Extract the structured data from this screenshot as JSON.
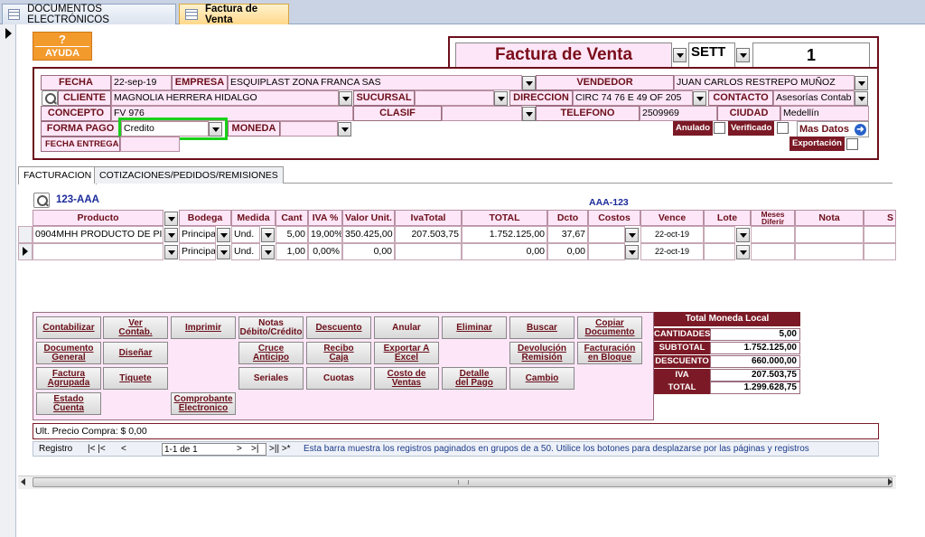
{
  "tabs": [
    {
      "label": "DOCUMENTOS ELECTRÓNICOS"
    },
    {
      "label": "Factura de Venta"
    }
  ],
  "help": {
    "icon": "?",
    "label": "AYUDA"
  },
  "header": {
    "title": "Factura de Venta",
    "serie": "SETT",
    "number": "1"
  },
  "form": {
    "fecha_label": "FECHA",
    "fecha": "22-sep-19",
    "empresa_label": "EMPRESA",
    "empresa": "ESQUIPLAST ZONA FRANCA SAS",
    "vendedor_label": "VENDEDOR",
    "vendedor": "JUAN CARLOS RESTREPO MUÑOZ",
    "cliente_label": "CLIENTE",
    "cliente": "MAGNOLIA HERRERA HIDALGO",
    "sucursal_label": "SUCURSAL",
    "sucursal": "",
    "direccion_label": "DIRECCION",
    "direccion": "CIRC 74 76 E 49 OF 205",
    "contacto_label": "CONTACTO",
    "contacto": "Asesorías Contab",
    "concepto_label": "CONCEPTO",
    "concepto": "FV 976",
    "clasif_label": "CLASIF",
    "clasif": "",
    "telefono_label": "TELEFONO",
    "telefono": "2509969",
    "ciudad_label": "CIUDAD",
    "ciudad": "Medellín",
    "forma_pago_label": "FORMA PAGO",
    "forma_pago": "Credito",
    "moneda_label": "MONEDA",
    "moneda": "",
    "fecha_entrega_label": "FECHA ENTREGA",
    "anulado_label": "Anulado",
    "verificado_label": "Verificado",
    "mas_datos_label": "Mas Datos",
    "exportacion_label": "Exportación"
  },
  "subtabs": [
    {
      "label": "FACTURACION"
    },
    {
      "label": "COTIZACIONES/PEDIDOS/REMISIONES"
    }
  ],
  "grid": {
    "code_left": "123-AAA",
    "code_right": "AAA-123",
    "headers": [
      "Producto",
      "Bodega",
      "Medida",
      "Cant",
      "IVA %",
      "Valor Unit.",
      "IvaTotal",
      "TOTAL",
      "Dcto",
      "Costos",
      "Vence",
      "Lote",
      "Meses Diferir",
      "Nota",
      "S"
    ],
    "rows": [
      {
        "producto": "0904MHH PRODUCTO DE PI",
        "bodega": "Principal",
        "medida": "Und.",
        "cant": "5,00",
        "iva": "19,00%",
        "valor": "350.425,00",
        "ivatotal": "207.503,75",
        "total": "1.752.125,00",
        "dcto": "37,67",
        "costos": "",
        "vence": "22-oct-19",
        "lote": "",
        "meses": "",
        "nota": ""
      },
      {
        "producto": "",
        "bodega": "Principal",
        "medida": "Und.",
        "cant": "1,00",
        "iva": "0,00%",
        "valor": "0,00",
        "ivatotal": "",
        "total": "0,00",
        "dcto": "0,00",
        "costos": "",
        "vence": "22-oct-19",
        "lote": "",
        "meses": "",
        "nota": ""
      }
    ]
  },
  "buttons": {
    "contabilizar": "Contabilizar",
    "ver_contab": "Ver\nContab.",
    "imprimir": "Imprimir",
    "notas": "Notas\nDébito/Crédito",
    "descuento": "Descuento",
    "anular": "Anular",
    "eliminar": "Eliminar",
    "buscar": "Buscar",
    "copiar": "Copiar\nDocumento",
    "doc_general": "Documento\nGeneral",
    "disenar": "Diseñar",
    "cruce": "Cruce\nAnticipo",
    "recibo": "Recibo\nCaja",
    "exportar": "Exportar A\nExcel",
    "devolucion": "Devolución\nRemisión",
    "fact_bloque": "Facturación\nen Bloque",
    "fact_agrupada": "Factura\nAgrupada",
    "tiquete": "Tiquete",
    "seriales": "Seriales",
    "cuotas": "Cuotas",
    "costo_ventas": "Costo de\nVentas",
    "detalle_pago": "Detalle\ndel Pago",
    "cambio": "Cambio",
    "estado_cuenta": "Estado\nCuenta",
    "comprobante": "Comprobante\nElectronico"
  },
  "totals": {
    "title": "Total Moneda Local",
    "rows": [
      {
        "label": "CANTIDADES",
        "value": "5,00"
      },
      {
        "label": "SUBTOTAL",
        "value": "1.752.125,00"
      },
      {
        "label": "DESCUENTO",
        "value": "660.000,00"
      },
      {
        "label": "IVA",
        "value": "207.503,75"
      },
      {
        "label": "TOTAL",
        "value": "1.299.628,75"
      }
    ]
  },
  "ult_precio": "Ult. Precio Compra: $ 0,00",
  "nav": {
    "label": "Registro",
    "first": "|< |<",
    "prev": "<",
    "position": "1-1 de 1",
    "next": ">",
    "last": ">|",
    "new": ">|| >*",
    "message": "Esta barra muestra los registros paginados en grupos de a 50.  Utilice los botones para desplazarse por las páginas y registros"
  },
  "colors": {
    "accent": "#6b0f1a",
    "label_bg": "#fde6f7",
    "highlight": "#19d019",
    "help": "#f39a2d"
  }
}
